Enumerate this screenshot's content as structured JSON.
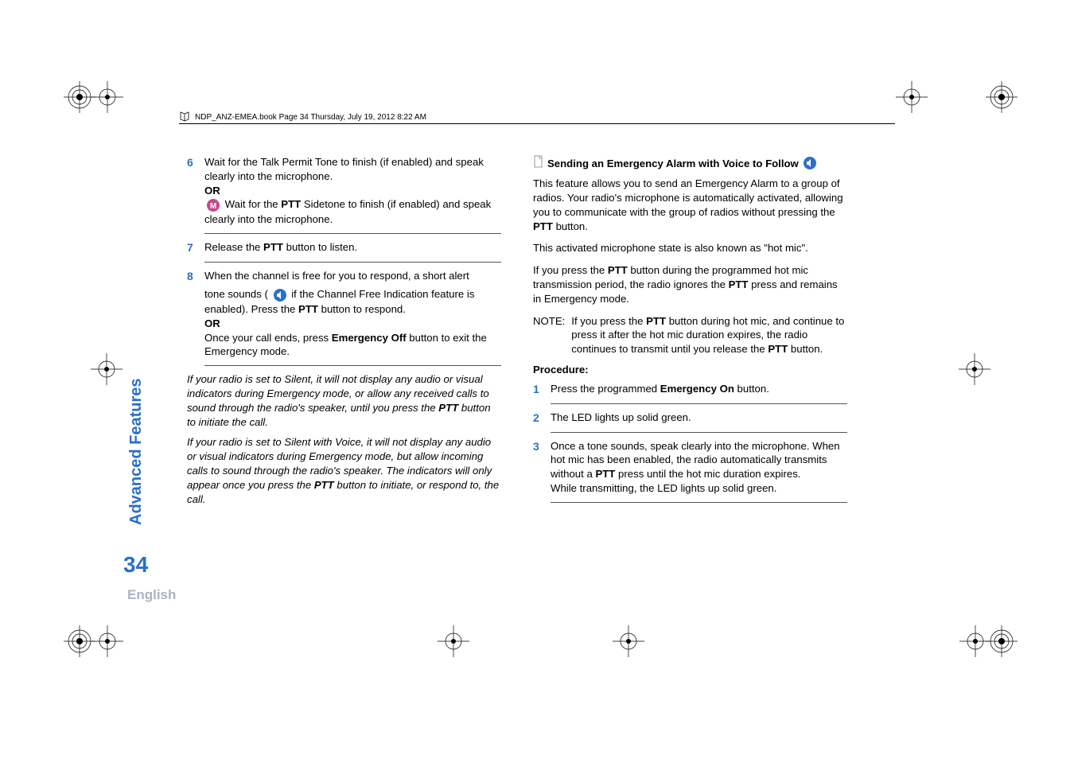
{
  "header": "NDP_ANZ-EMEA.book  Page 34  Thursday, July 19, 2012  8:22 AM",
  "left": {
    "step6": {
      "num": "6",
      "line1_a": "Wait for the Talk Permit Tone to finish (if enabled) and speak clearly into the microphone.",
      "or": "OR",
      "line2_a": " Wait for the ",
      "line2_b": "PTT",
      "line2_c": " Sidetone to finish (if enabled) and speak clearly into the microphone."
    },
    "step7": {
      "num": "7",
      "a": "Release the ",
      "b": "PTT",
      "c": " button to listen."
    },
    "step8": {
      "num": "8",
      "line1": "When the channel is free for you to respond, a short alert",
      "line2_a": "tone sounds ( ",
      "line2_b": " if the Channel Free Indication feature is enabled). Press the ",
      "line2_c": "PTT",
      "line2_d": " button to respond.",
      "or": "OR",
      "line3_a": "Once your call ends, press ",
      "line3_b": "Emergency Off",
      "line3_c": " button to exit the Emergency mode."
    },
    "note1_a": "If your radio is set to Silent, it will not display any audio or visual indicators during Emergency mode, or allow any received calls to sound through the radio's speaker, until you press the ",
    "note1_b": "PTT",
    "note1_c": " button to initiate the call.",
    "note2_a": "If your radio is set to Silent with Voice, it will not display any audio or visual indicators during Emergency mode, but allow incoming calls to sound through the radio's speaker. The indicators will only appear once you press the ",
    "note2_b": "PTT",
    "note2_c": " button to initiate, or respond to, the call."
  },
  "right": {
    "heading_a": "Sending an Emergency Alarm with Voice to Follow ",
    "p1_a": "This feature allows you to send an Emergency Alarm to a group of radios. Your radio's microphone is automatically activated, allowing you to communicate with the group of radios without pressing the ",
    "p1_b": "PTT",
    "p1_c": " button.",
    "p2": "This activated microphone state is also known as \"hot mic\".",
    "p3_a": "If you press the ",
    "p3_b": "PTT",
    "p3_c": " button during the programmed hot mic transmission period, the radio ignores the ",
    "p3_d": "PTT",
    "p3_e": " press and remains in Emergency mode.",
    "note_label": "NOTE:",
    "note_a": "If you press the ",
    "note_b": "PTT",
    "note_c": " button during hot mic, and continue to press it after the hot mic duration expires, the radio continues to transmit until you release the ",
    "note_d": "PTT",
    "note_e": " button.",
    "procedure": "Procedure:",
    "s1": {
      "num": "1",
      "a": "Press the programmed ",
      "b": "Emergency On",
      "c": " button."
    },
    "s2": {
      "num": "2",
      "a": "The LED lights up solid green."
    },
    "s3": {
      "num": "3",
      "a": "Once a tone sounds, speak clearly into the microphone. When hot mic has been enabled, the radio automatically transmits without a ",
      "b": "PTT",
      "c": " press until the hot mic duration expires.",
      "d": "While transmitting, the LED lights up solid green."
    }
  },
  "sidebar": "Advanced Features",
  "pageNum": "34",
  "lang": "English"
}
